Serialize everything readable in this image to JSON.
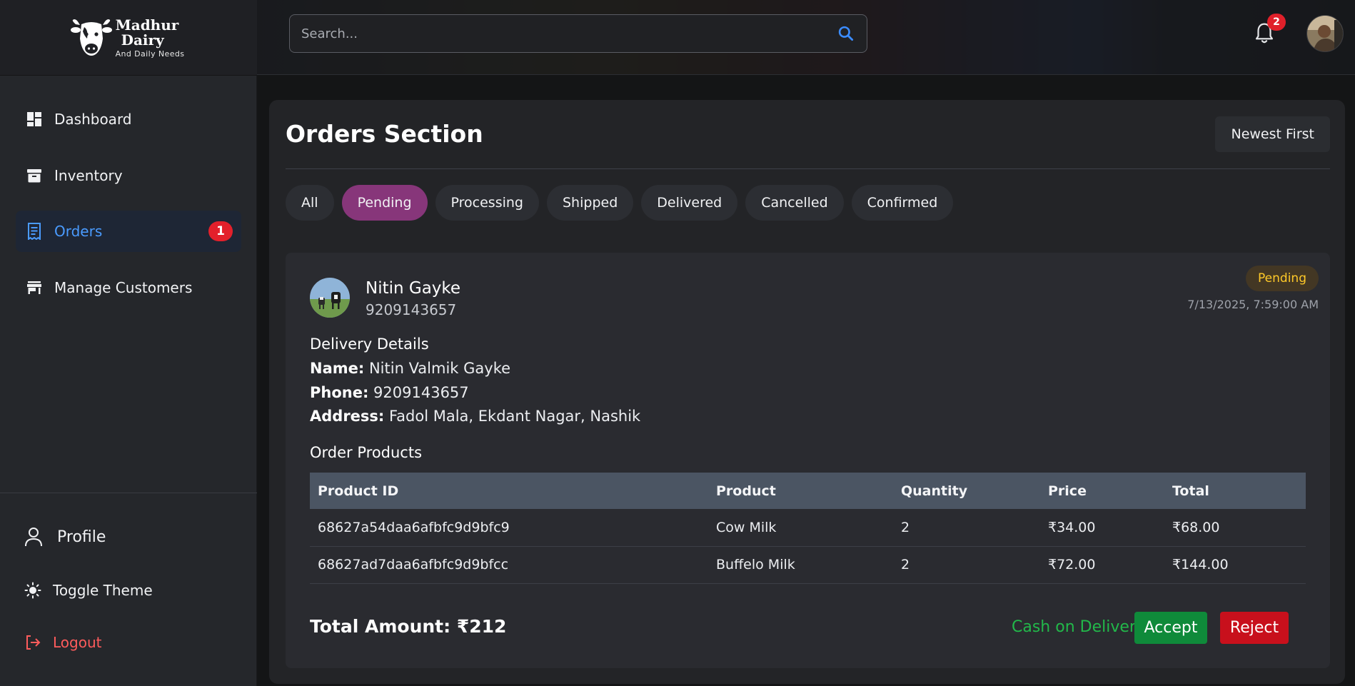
{
  "brand": {
    "title_line1": "Madhur",
    "title_line2": "Dairy",
    "subtitle": "And Daily Needs"
  },
  "search": {
    "placeholder": "Search..."
  },
  "notifications": {
    "count": "2"
  },
  "sidebar": {
    "items": [
      {
        "label": "Dashboard",
        "icon": "dashboard-icon"
      },
      {
        "label": "Inventory",
        "icon": "archive-box-icon"
      },
      {
        "label": "Orders",
        "icon": "receipt-icon",
        "badge": "1",
        "active": true
      },
      {
        "label": "Manage Customers",
        "icon": "store-icon"
      }
    ],
    "bottom": {
      "profile": "Profile",
      "theme": "Toggle Theme",
      "logout": "Logout"
    }
  },
  "main": {
    "title": "Orders Section",
    "sort_label": "Newest First",
    "tabs": [
      {
        "label": "All"
      },
      {
        "label": "Pending",
        "active": true
      },
      {
        "label": "Processing"
      },
      {
        "label": "Shipped"
      },
      {
        "label": "Delivered"
      },
      {
        "label": "Cancelled"
      },
      {
        "label": "Confirmed"
      }
    ]
  },
  "order": {
    "customer_name": "Nitin Gayke",
    "customer_phone": "9209143657",
    "status": "Pending",
    "date": "7/13/2025, 7:59:00 AM",
    "delivery_heading": "Delivery Details",
    "name_label": "Name:",
    "name_value": "Nitin Valmik Gayke",
    "phone_label": "Phone:",
    "phone_value": "9209143657",
    "address_label": "Address:",
    "address_value": "Fadol Mala, Ekdant Nagar, Nashik",
    "products_heading": "Order Products",
    "columns": [
      "Product ID",
      "Product",
      "Quantity",
      "Price",
      "Total"
    ],
    "rows": [
      [
        "68627a54daa6afbfc9d9bfc9",
        "Cow Milk",
        "2",
        "₹34.00",
        "₹68.00"
      ],
      [
        "68627ad7daa6afbfc9d9bfcc",
        "Buffelo Milk",
        "2",
        "₹72.00",
        "₹144.00"
      ]
    ],
    "total_label": "Total Amount: ₹212",
    "payment_method": "Cash on Delivery",
    "accept_label": "Accept",
    "reject_label": "Reject"
  },
  "colors": {
    "accent_active_tab": "#87367a",
    "nav_active": "#4a9bff",
    "accept": "#0f8a3a",
    "reject": "#c8101c",
    "status_pending": "#ffc928",
    "cod_green": "#22b84a"
  }
}
